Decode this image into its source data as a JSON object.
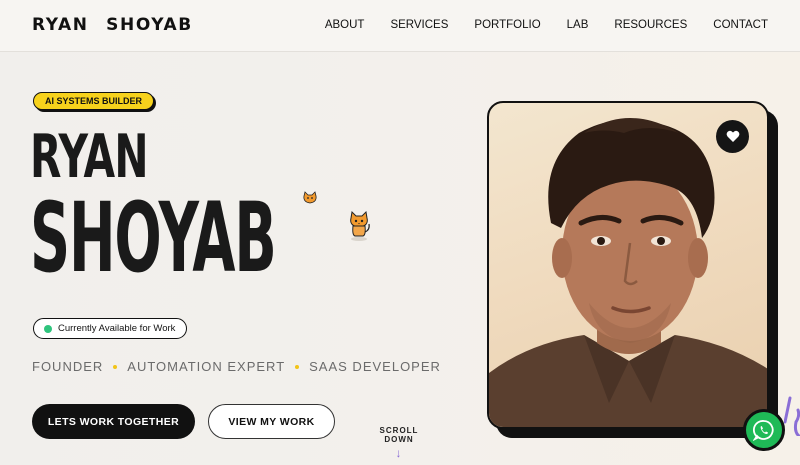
{
  "nav": {
    "logo": "RYAN SHOYAB",
    "links": [
      "ABOUT",
      "SERVICES",
      "PORTFOLIO",
      "LAB",
      "RESOURCES",
      "CONTACT"
    ]
  },
  "hero": {
    "badge": "AI SYSTEMS BUILDER",
    "first_name": "RYAN",
    "last_name": "SHOYAB",
    "availability": "Currently Available for Work",
    "roles": [
      "FOUNDER",
      "AUTOMATION EXPERT",
      "SAAS DEVELOPER"
    ],
    "primary_button": "LETS WORK TOGETHER",
    "secondary_button": "VIEW MY WORK",
    "scroll_label": "SCROLL DOWN"
  },
  "colors": {
    "accent_yellow": "#f7d21c",
    "available_green": "#2fc47d",
    "whatsapp_green": "#1fba57",
    "scroll_purple": "#8a6ed6"
  },
  "icons": {
    "like": "heart-icon",
    "chat": "whatsapp-icon",
    "mascot": "cat-mascot-icon"
  }
}
